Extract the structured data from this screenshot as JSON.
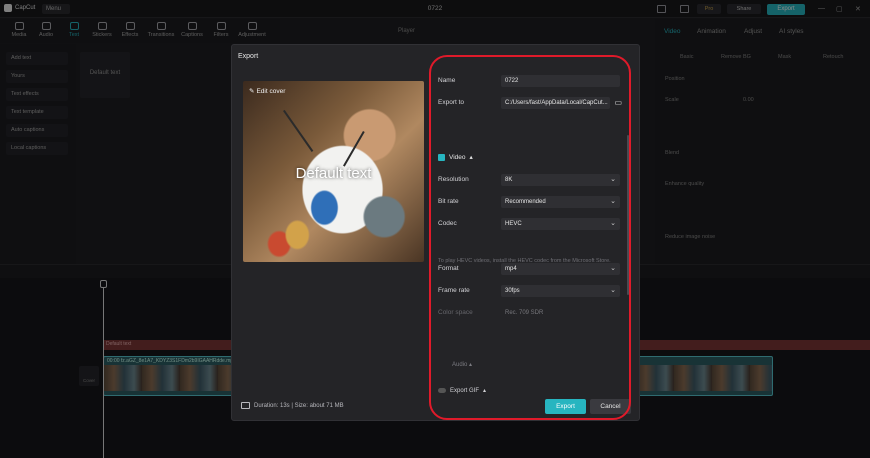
{
  "app": {
    "name": "CapCut",
    "menu_label": "Menu",
    "project_title": "0722",
    "pro_label": "Pro",
    "share_label": "Share",
    "export_label": "Export"
  },
  "media_tabs": [
    {
      "label": "Media",
      "icon": "media-icon"
    },
    {
      "label": "Audio",
      "icon": "audio-icon"
    },
    {
      "label": "Text",
      "icon": "text-icon"
    },
    {
      "label": "Stickers",
      "icon": "stickers-icon"
    },
    {
      "label": "Effects",
      "icon": "effects-icon"
    },
    {
      "label": "Transitions",
      "icon": "transitions-icon"
    },
    {
      "label": "Captions",
      "icon": "captions-icon"
    },
    {
      "label": "Filters",
      "icon": "filters-icon"
    },
    {
      "label": "Adjustment",
      "icon": "adjustment-icon"
    }
  ],
  "text_sidebar": [
    "Add text",
    "Yours",
    "Text effects",
    "Text template",
    "Auto captions",
    "Local captions"
  ],
  "default_tile_label": "Default text",
  "player_label": "Player",
  "right_panel": {
    "tabs": [
      "Video",
      "Animation",
      "Adjust",
      "AI styles"
    ],
    "subtabs": [
      "Basic",
      "Remove BG",
      "Mask",
      "Retouch"
    ],
    "rows": [
      "Position",
      "Scale",
      "Blend",
      "Enhance quality",
      "Reduce image noise"
    ],
    "scale_value": "0.00"
  },
  "timeline": {
    "main_track_label": "00:00 fz.aGZ_8e1A7_KDYZ3S1FDm2b9IGAAHRdde.mp4",
    "red_track_label": "Default text",
    "cover_label": "Cover"
  },
  "dialog": {
    "title": "Export",
    "edit_cover_label": "Edit cover",
    "preview_overlay_text": "Default text",
    "name_label": "Name",
    "name_value": "0722",
    "export_to_label": "Export to",
    "export_to_value": "C:/Users/fast/AppData/Local/CapCut...",
    "video_section_label": "Video",
    "resolution_label": "Resolution",
    "resolution_value": "8K",
    "bitrate_label": "Bit rate",
    "bitrate_value": "Recommended",
    "codec_label": "Codec",
    "codec_value": "HEVC",
    "hevc_note": "To play HEVC videos, install the HEVC codec from the Microsoft Store.",
    "format_label": "Format",
    "format_value": "mp4",
    "framerate_label": "Frame rate",
    "framerate_value": "30fps",
    "color_space_label": "Color space",
    "color_space_value": "Rec. 709 SDR",
    "audio_label": "Audio",
    "gif_label": "Export GIF",
    "footer_info": "Duration: 13s | Size: about 71 MB",
    "export_button": "Export",
    "cancel_button": "Cancel"
  },
  "colors": {
    "accent": "#27b5c0",
    "highlight_ring": "#e01a2a",
    "dialog_bg": "#242427"
  }
}
